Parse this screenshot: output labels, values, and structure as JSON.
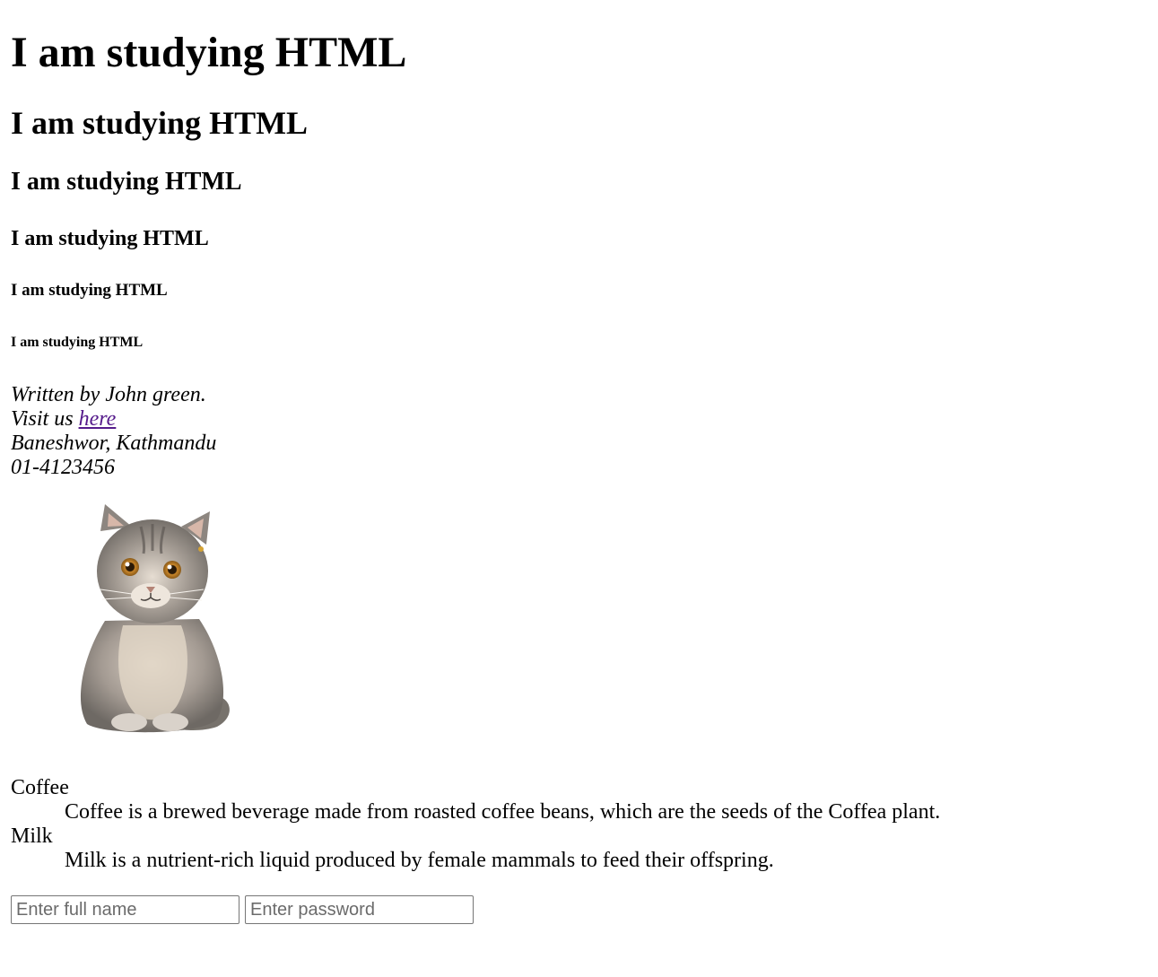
{
  "headings": [
    "I am studying HTML",
    "I am studying HTML",
    "I am studying HTML",
    "I am studying HTML",
    "I am studying HTML",
    "I am studying HTML"
  ],
  "address": {
    "written_by": "Written by John green.",
    "visit_prefix": "Visit us ",
    "link_text": "here",
    "location": "Baneshwor, Kathmandu",
    "phone": "01-4123456"
  },
  "image": {
    "icon": "cat-photo"
  },
  "definitions": [
    {
      "term": "Coffee",
      "description": "Coffee is a brewed beverage made from roasted coffee beans, which are the seeds of the Coffea plant."
    },
    {
      "term": "Milk",
      "description": "Milk is a nutrient-rich liquid produced by female mammals to feed their offspring."
    }
  ],
  "form": {
    "name_placeholder": "Enter full name",
    "name_value": "",
    "password_placeholder": "Enter password",
    "password_value": ""
  }
}
